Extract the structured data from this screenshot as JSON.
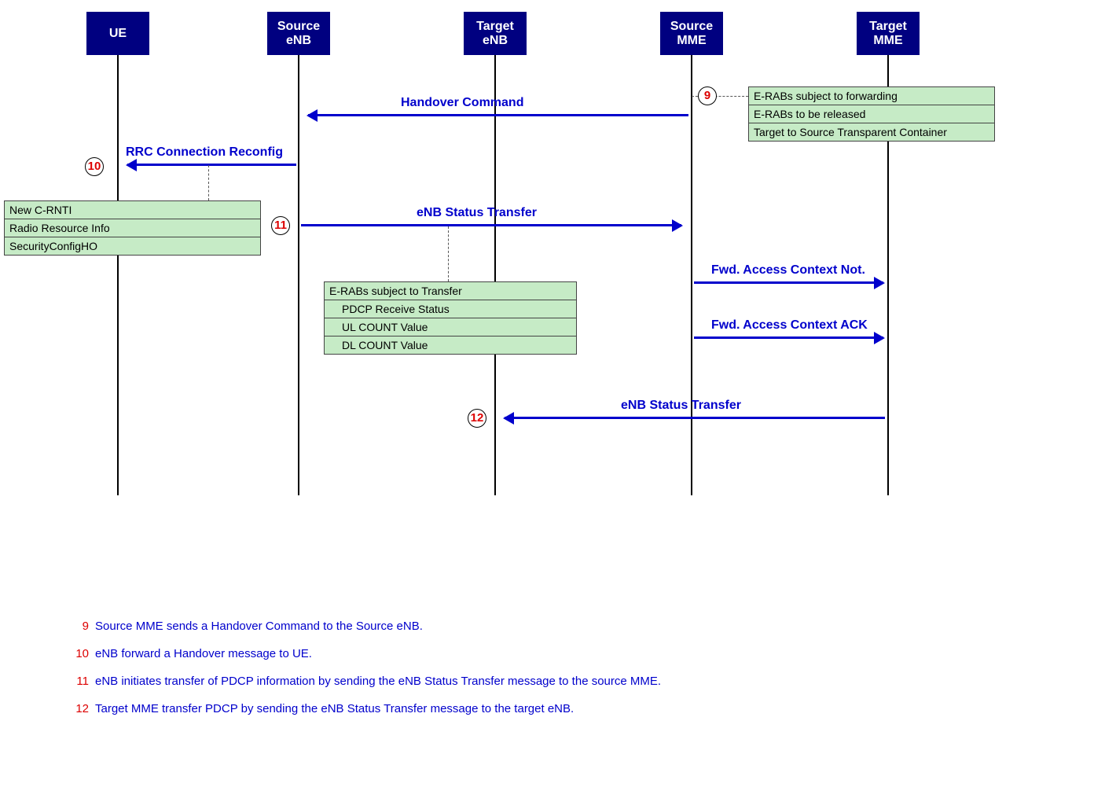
{
  "actors": {
    "ue": "UE",
    "senb": "Source\neNB",
    "tenb": "Target\neNB",
    "smme": "Source\nMME",
    "tmme": "Target\nMME"
  },
  "arrows": {
    "handover": "Handover Command",
    "rrc": "RRC Connection Reconfig",
    "enbst1": "eNB Status Transfer",
    "fwdnot": "Fwd. Access Context Not.",
    "fwdack": "Fwd. Access Context ACK",
    "enbst2": "eNB Status Transfer"
  },
  "steps": {
    "s9": "9",
    "s10": "10",
    "s11": "11",
    "s12": "12"
  },
  "box1": {
    "r1": "E-RABs subject to forwarding",
    "r2": "E-RABs to be released",
    "r3": "Target to Source Transparent Container"
  },
  "box2": {
    "r1": "New C-RNTI",
    "r2": "Radio Resource Info",
    "r3": "SecurityConfigHO"
  },
  "box3": {
    "r1": "E-RABs subject to Transfer",
    "r2": "PDCP Receive Status",
    "r3": "UL COUNT Value",
    "r4": "DL COUNT Value"
  },
  "legend": {
    "l9": "Source MME sends a Handover Command to the Source eNB.",
    "l10": "eNB forward a Handover message to UE.",
    "l11": "eNB initiates transfer of PDCP information by sending the eNB Status Transfer message to the source MME.",
    "l12": "Target MME transfer PDCP by sending the eNB Status Transfer message to the target eNB."
  }
}
